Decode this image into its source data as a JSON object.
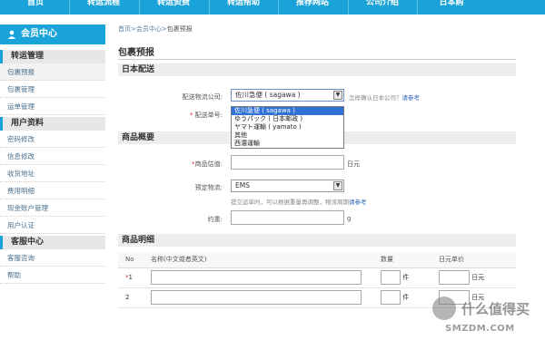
{
  "topnav": {
    "items": [
      "首页",
      "转运流程",
      "转运资费",
      "转运帮助",
      "推荐网站",
      "公司介绍",
      "日本购"
    ]
  },
  "sidebar": {
    "header": "会员中心",
    "groups": [
      {
        "title": "转运管理",
        "links": [
          "包裹预报",
          "包裹管理",
          "运单管理"
        ]
      },
      {
        "title": "用户资料",
        "links": [
          "密码修改",
          "信息修改",
          "收货地址",
          "费用明细",
          "现金账户管理",
          "用户认证"
        ]
      },
      {
        "title": "客服中心",
        "links": [
          "客服咨询",
          "帮助"
        ]
      }
    ]
  },
  "breadcrumb": {
    "home": "首页",
    "sep": ">",
    "member": "会员中心",
    "current": "包裹预报"
  },
  "page_title": "包裹预报",
  "section_japan": {
    "title": "日本配送",
    "carrier_label": "配送物流公司:",
    "carrier_value": "佐川急便 ( sagawa )",
    "carrier_hint": "怎样确认日本公司？",
    "carrier_hint_link": "请参考",
    "tracking_label": "配送单号:",
    "tracking_star": "*",
    "carrier_options": [
      "佐川急便 ( sagawa )",
      "ゆうパック ( 日本邮政 )",
      "ヤマト運輸 ( yamato )",
      "其他",
      "西濃運輸"
    ]
  },
  "section_summary": {
    "title": "商品概要",
    "value_star": "*",
    "value_label": "商品估值:",
    "value_unit": "日元",
    "shipping_label": "预定物流:",
    "shipping_value": "EMS",
    "shipping_hint": "提交运单时，可以根据重量再调整，物流周期",
    "shipping_hint_link": "请参考",
    "weight_label": "约重:",
    "weight_unit": "g"
  },
  "section_detail": {
    "title": "商品明细",
    "columns": [
      "No",
      "名称(中文或者英文)",
      "数量",
      "日元单价"
    ],
    "rows": [
      {
        "no": "1",
        "qty_unit": "件",
        "price_unit": "日元"
      },
      {
        "no": "2",
        "qty_unit": "件",
        "price_unit": "日元"
      }
    ]
  },
  "watermark": {
    "text": "什么值得买",
    "sub": "SMZDM.COM"
  }
}
